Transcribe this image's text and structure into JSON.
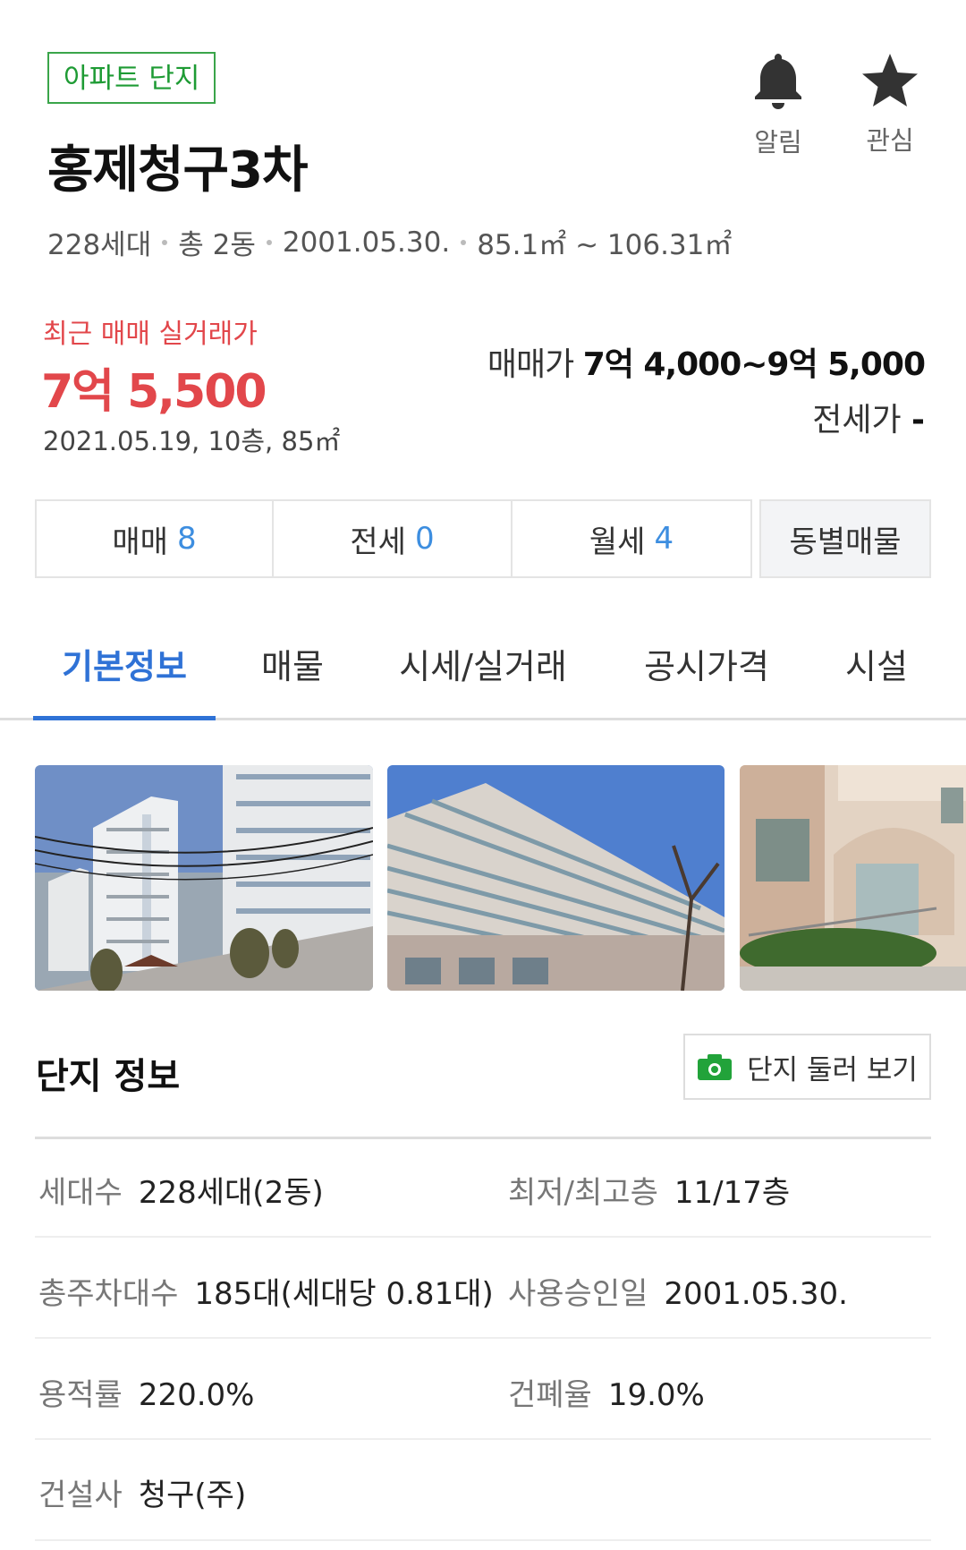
{
  "header": {
    "badge": "아파트 단지",
    "title": "홍제청구3차",
    "meta": [
      "228세대",
      "총 2동",
      "2001.05.30.",
      "85.1㎡ ~ 106.31㎡"
    ],
    "alarm_label": "알림",
    "favorite_label": "관심"
  },
  "price": {
    "recent_label": "최근 매매 실거래가",
    "recent_price": "7억 5,500",
    "recent_detail": "2021.05.19, 10층, 85㎡",
    "sale_label": "매매가",
    "sale_range": "7억 4,000~9억 5,000",
    "jeonse_label": "전세가",
    "jeonse_value": "-"
  },
  "deals": {
    "sale": {
      "label": "매매",
      "count": "8"
    },
    "jeonse": {
      "label": "전세",
      "count": "0"
    },
    "monthly": {
      "label": "월세",
      "count": "4"
    },
    "by_building": "동별매물"
  },
  "tabs": [
    "기본정보",
    "매물",
    "시세/실거래",
    "공시가격",
    "시설"
  ],
  "complex": {
    "title": "단지 정보",
    "tour_button": "단지 둘러 보기",
    "rows": [
      [
        {
          "k": "세대수",
          "v": "228세대(2동)"
        },
        {
          "k": "최저/최고층",
          "v": "11/17층"
        }
      ],
      [
        {
          "k": "총주차대수",
          "v": "185대(세대당 0.81대)"
        },
        {
          "k": "사용승인일",
          "v": "2001.05.30."
        }
      ],
      [
        {
          "k": "용적률",
          "v": "220.0%"
        },
        {
          "k": "건폐율",
          "v": "19.0%"
        }
      ],
      [
        {
          "k": "건설사",
          "v": "청구(주)"
        }
      ]
    ]
  },
  "colors": {
    "accent": "#2f72d6",
    "price_red": "#e2474b",
    "badge_green": "#1e9b34",
    "count_blue": "#3d8ee0"
  }
}
